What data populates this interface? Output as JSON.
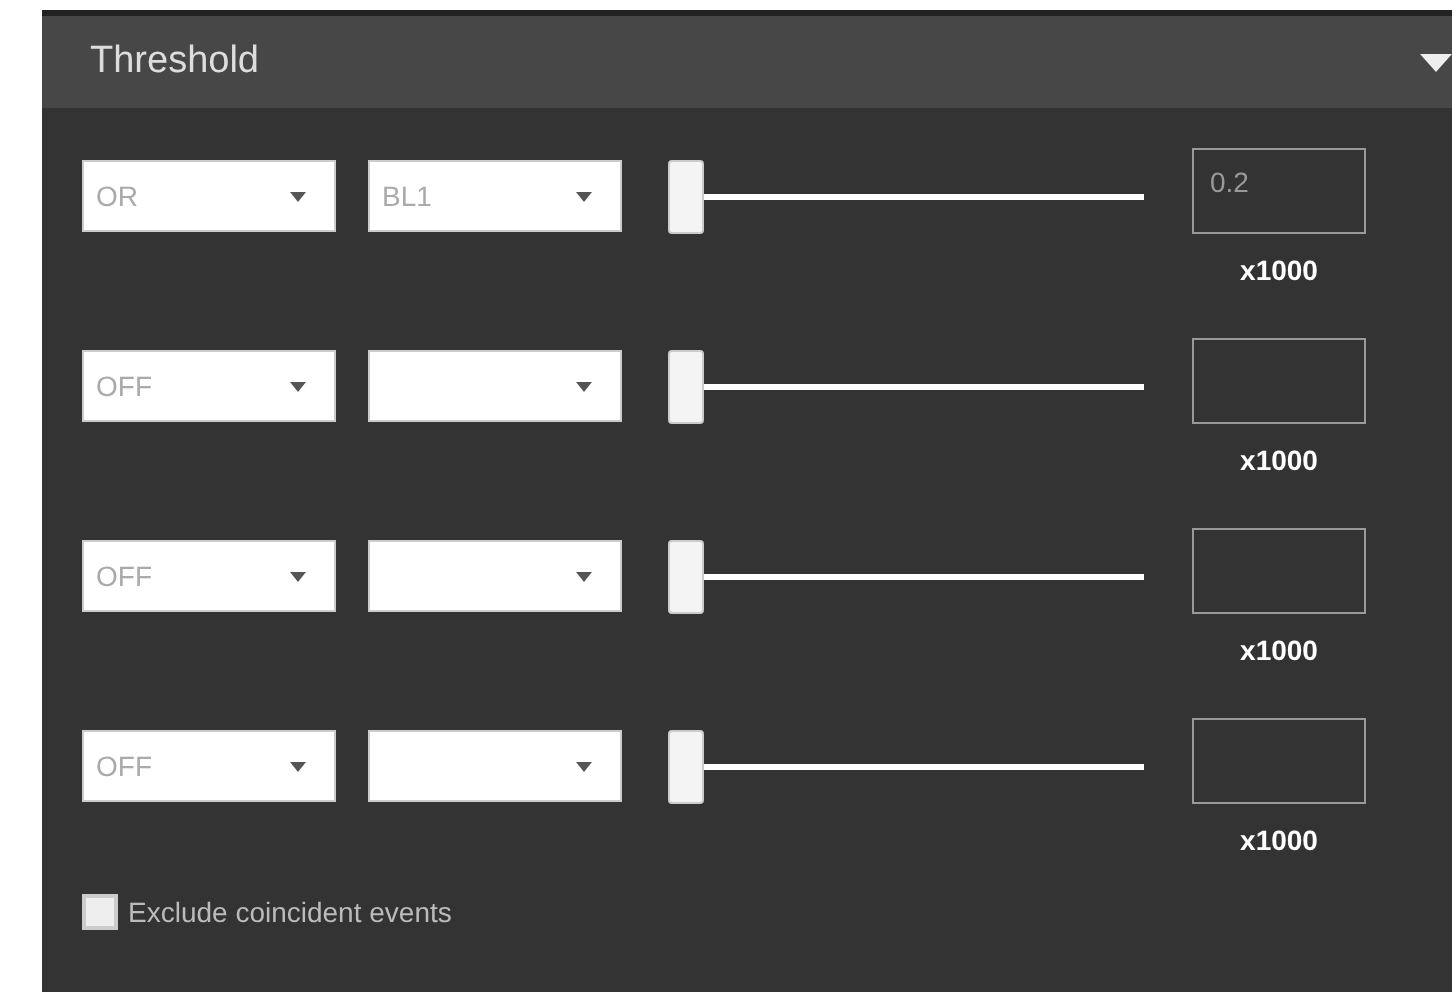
{
  "panel": {
    "title": "Threshold",
    "expanded": true
  },
  "rows": [
    {
      "logic": "OR",
      "channel": "BL1",
      "level": 0,
      "value": "0.2",
      "unit": "x1000"
    },
    {
      "logic": "OFF",
      "level": 0,
      "unit": "x1000"
    },
    {
      "logic": "OFF",
      "level": 0,
      "unit": "x1000"
    },
    {
      "logic": "OFF",
      "level": 0,
      "unit": "x1000"
    }
  ],
  "exclude": {
    "label": "Exclude coincident events",
    "checked": false
  }
}
